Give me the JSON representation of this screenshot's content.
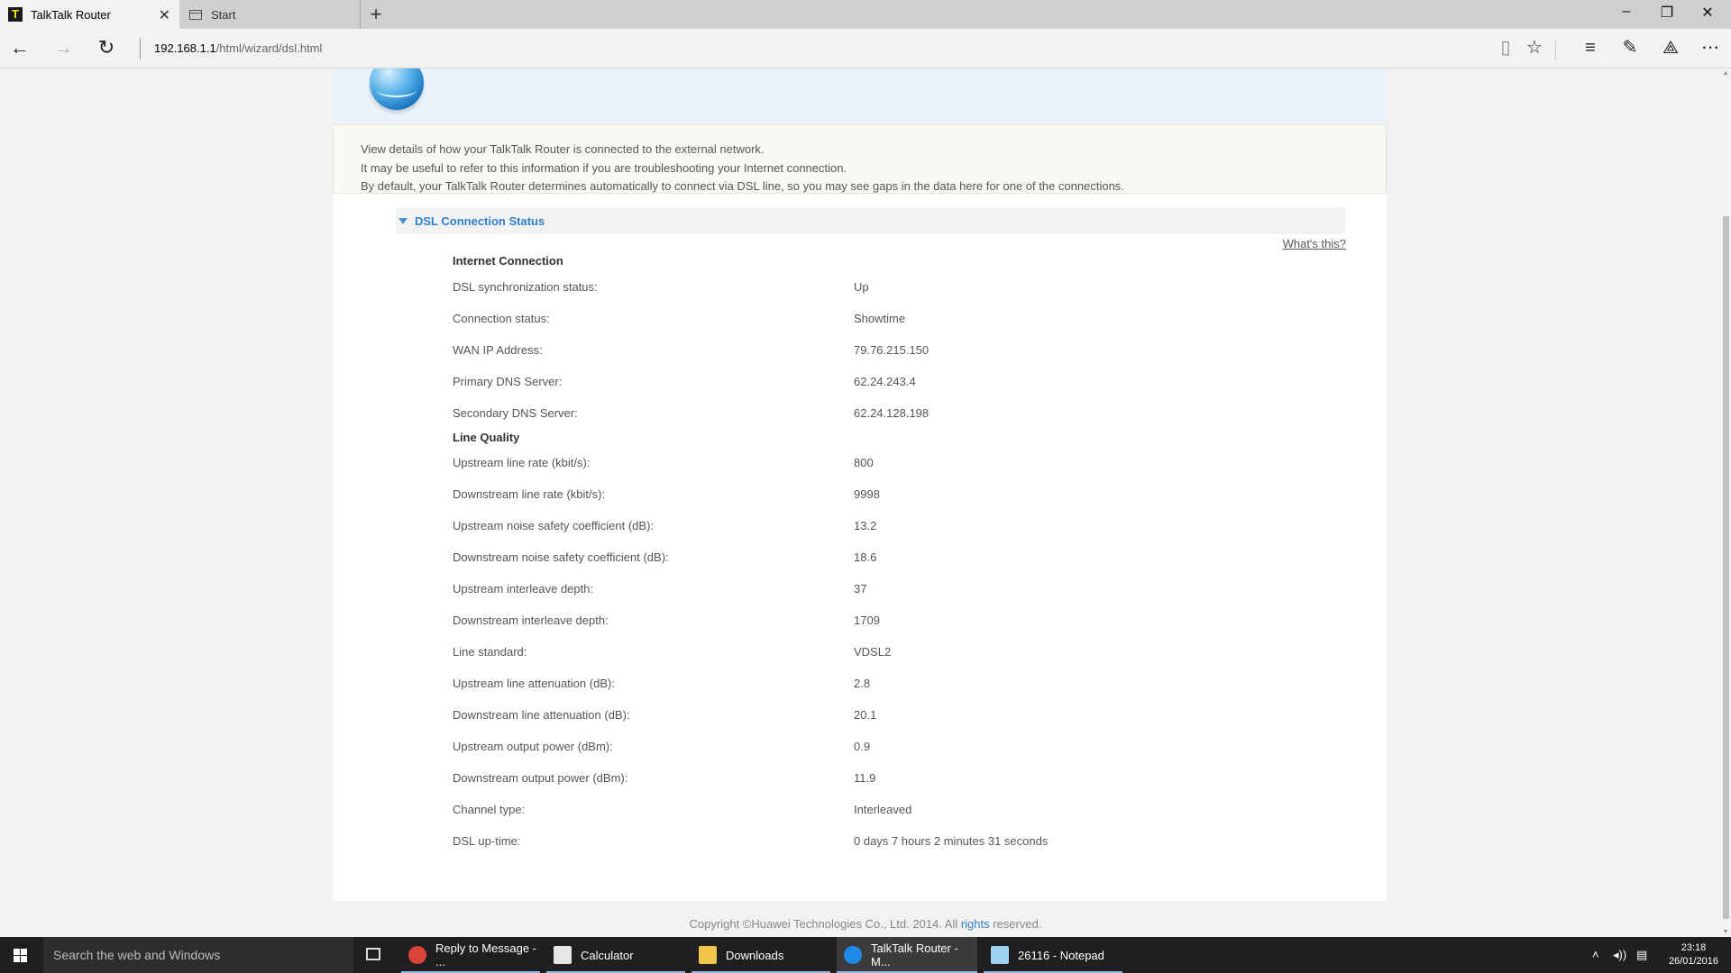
{
  "browser": {
    "tabs": [
      {
        "title": "TalkTalk Router",
        "active": true
      },
      {
        "title": "Start",
        "active": false
      }
    ],
    "url": {
      "host": "192.168.1.1",
      "path": "/html/wizard/dsl.html"
    }
  },
  "page": {
    "intro_lines": [
      "View details of how your TalkTalk Router is connected to the external network.",
      "It may be useful to refer to this information if you are troubleshooting your Internet connection.",
      "By default, your TalkTalk Router determines automatically to connect via DSL line, so you may see gaps in the data here for one of the connections."
    ],
    "section_title": "DSL Connection Status",
    "whats_this": "What's this?",
    "internet_connection": {
      "title": "Internet Connection",
      "rows": [
        {
          "label": "DSL synchronization status:",
          "value": "Up"
        },
        {
          "label": "Connection status:",
          "value": "Showtime"
        },
        {
          "label": "WAN IP Address:",
          "value": "79.76.215.150"
        },
        {
          "label": "Primary DNS Server:",
          "value": "62.24.243.4"
        },
        {
          "label": "Secondary DNS Server:",
          "value": "62.24.128.198"
        }
      ]
    },
    "line_quality": {
      "title": "Line Quality",
      "rows": [
        {
          "label": "Upstream line rate (kbit/s):",
          "value": "800"
        },
        {
          "label": "Downstream line rate (kbit/s):",
          "value": "9998"
        },
        {
          "label": "Upstream noise safety coefficient (dB):",
          "value": "13.2"
        },
        {
          "label": "Downstream noise safety coefficient (dB):",
          "value": "18.6"
        },
        {
          "label": "Upstream interleave depth:",
          "value": "37"
        },
        {
          "label": "Downstream interleave depth:",
          "value": "1709"
        },
        {
          "label": "Line standard:",
          "value": "VDSL2"
        },
        {
          "label": "Upstream line attenuation (dB):",
          "value": "2.8"
        },
        {
          "label": "Downstream line attenuation (dB):",
          "value": "20.1"
        },
        {
          "label": "Upstream output power (dBm):",
          "value": "0.9"
        },
        {
          "label": "Downstream output power (dBm):",
          "value": "11.9"
        },
        {
          "label": "Channel type:",
          "value": "Interleaved"
        },
        {
          "label": "DSL up-time:",
          "value": "0 days 7 hours 2 minutes 31 seconds"
        }
      ]
    },
    "copyright_prefix": "Copyright ©Huawei Technologies Co., Ltd. 2014. All ",
    "copyright_link": "rights",
    "copyright_suffix": " reserved."
  },
  "taskbar": {
    "search_placeholder": "Search the web and Windows",
    "items": [
      {
        "label": "Reply to Message - ...",
        "icon": "chrome-icon",
        "color": "#db4437"
      },
      {
        "label": "Calculator",
        "icon": "calculator-icon",
        "color": "#e6e6e6"
      },
      {
        "label": "Downloads",
        "icon": "folder-icon",
        "color": "#f0c648"
      },
      {
        "label": "TalkTalk Router - M...",
        "icon": "edge-icon",
        "color": "#1e88e5"
      },
      {
        "label": "26116 - Notepad",
        "icon": "notepad-icon",
        "color": "#9fd2f0"
      }
    ],
    "time": "23:18",
    "date": "26/01/2016"
  },
  "colors": {
    "accent": "#2d7fd0",
    "header_band": "#eaf3fc",
    "info_band": "#f9faf3"
  }
}
